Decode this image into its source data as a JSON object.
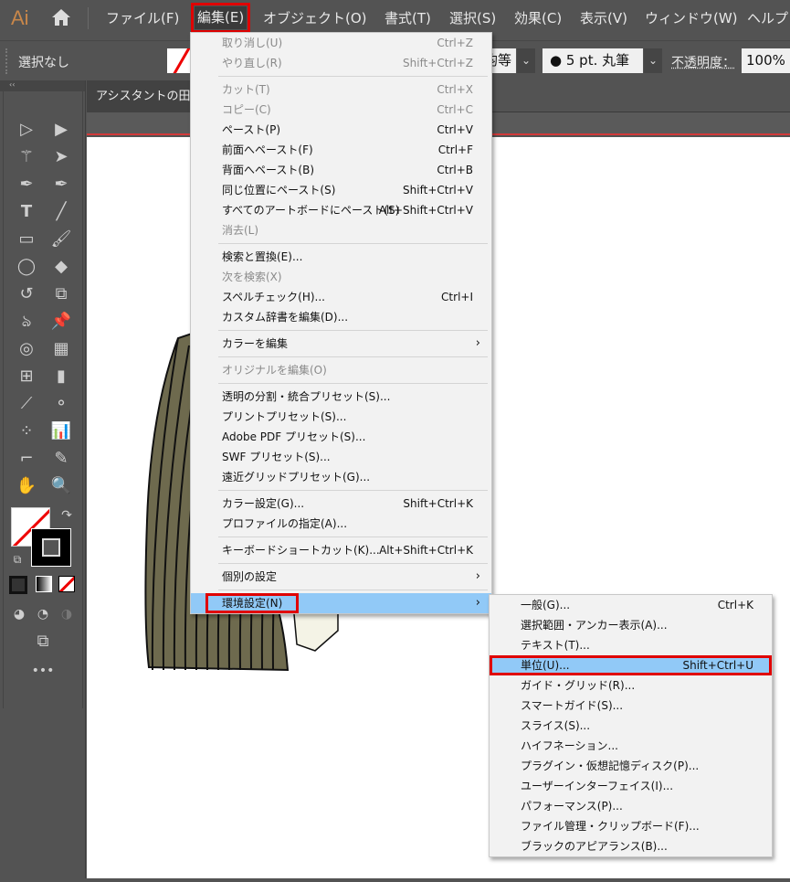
{
  "app": {
    "logo": "Ai",
    "home_icon": "home-icon"
  },
  "menubar": [
    "ファイル(F)",
    "編集(E)",
    "オブジェクト(O)",
    "書式(T)",
    "選択(S)",
    "効果(C)",
    "表示(V)",
    "ウィンドウ(W)",
    "ヘルプ"
  ],
  "control": {
    "selection": "選択なし",
    "stroke_profile": "均等",
    "brush": "● 5 pt. 丸筆",
    "opacity_label": "不透明度：",
    "opacity_value": "100%"
  },
  "document": {
    "tab_title": "アシスタントの田中"
  },
  "edit_menu": [
    {
      "label": "取り消し(U)",
      "shortcut": "Ctrl+Z",
      "disabled": true
    },
    {
      "label": "やり直し(R)",
      "shortcut": "Shift+Ctrl+Z",
      "disabled": true
    },
    {
      "sep": true
    },
    {
      "label": "カット(T)",
      "shortcut": "Ctrl+X",
      "disabled": true
    },
    {
      "label": "コピー(C)",
      "shortcut": "Ctrl+C",
      "disabled": true
    },
    {
      "label": "ペースト(P)",
      "shortcut": "Ctrl+V"
    },
    {
      "label": "前面へペースト(F)",
      "shortcut": "Ctrl+F"
    },
    {
      "label": "背面へペースト(B)",
      "shortcut": "Ctrl+B"
    },
    {
      "label": "同じ位置にペースト(S)",
      "shortcut": "Shift+Ctrl+V"
    },
    {
      "label": "すべてのアートボードにペースト(S)",
      "shortcut": "Alt+Shift+Ctrl+V"
    },
    {
      "label": "消去(L)",
      "disabled": true
    },
    {
      "sep": true
    },
    {
      "label": "検索と置換(E)..."
    },
    {
      "label": "次を検索(X)",
      "disabled": true
    },
    {
      "label": "スペルチェック(H)...",
      "shortcut": "Ctrl+I"
    },
    {
      "label": "カスタム辞書を編集(D)..."
    },
    {
      "sep": true
    },
    {
      "label": "カラーを編集",
      "submenu": true
    },
    {
      "sep": true
    },
    {
      "label": "オリジナルを編集(O)",
      "disabled": true
    },
    {
      "sep": true
    },
    {
      "label": "透明の分割・統合プリセット(S)..."
    },
    {
      "label": "プリントプリセット(S)..."
    },
    {
      "label": "Adobe PDF プリセット(S)..."
    },
    {
      "label": "SWF プリセット(S)..."
    },
    {
      "label": "遠近グリッドプリセット(G)..."
    },
    {
      "sep": true
    },
    {
      "label": "カラー設定(G)...",
      "shortcut": "Shift+Ctrl+K"
    },
    {
      "label": "プロファイルの指定(A)..."
    },
    {
      "sep": true
    },
    {
      "label": "キーボードショートカット(K)...",
      "shortcut": "Alt+Shift+Ctrl+K"
    },
    {
      "sep": true
    },
    {
      "label": "個別の設定",
      "submenu": true
    },
    {
      "sep": true
    },
    {
      "label": "環境設定(N)",
      "submenu": true,
      "highlighted": true
    }
  ],
  "prefs_submenu": [
    {
      "label": "一般(G)...",
      "shortcut": "Ctrl+K"
    },
    {
      "label": "選択範囲・アンカー表示(A)..."
    },
    {
      "label": "テキスト(T)..."
    },
    {
      "label": "単位(U)...",
      "shortcut": "Shift+Ctrl+U",
      "highlighted": true
    },
    {
      "label": "ガイド・グリッド(R)..."
    },
    {
      "label": "スマートガイド(S)..."
    },
    {
      "label": "スライス(S)..."
    },
    {
      "label": "ハイフネーション..."
    },
    {
      "label": "プラグイン・仮想記憶ディスク(P)..."
    },
    {
      "label": "ユーザーインターフェイス(I)..."
    },
    {
      "label": "パフォーマンス(P)..."
    },
    {
      "label": "ファイル管理・クリップボード(F)..."
    },
    {
      "label": "ブラックのアピアランス(B)..."
    }
  ],
  "colors": {
    "highlight": "#91c9f7",
    "annotation": "#e00000",
    "artwork_fill": "#6e6a4e"
  }
}
